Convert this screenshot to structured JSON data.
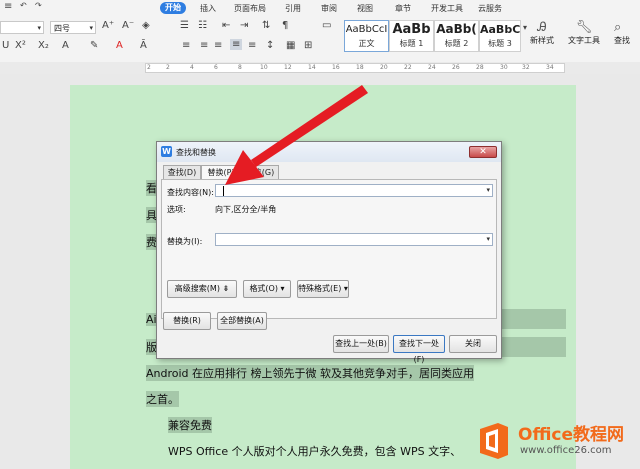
{
  "ribbon": {
    "tabs": [
      "开始",
      "插入",
      "页面布局",
      "引用",
      "审阅",
      "视图",
      "章节",
      "开发工具",
      "云服务"
    ],
    "font_size_value": "四号",
    "styles": [
      {
        "preview": "AaBbCcI",
        "name": "正文"
      },
      {
        "preview": "AaBb",
        "name": "标题 1"
      },
      {
        "preview": "AaBb(",
        "name": "标题 2"
      },
      {
        "preview": "AaBbC",
        "name": "标题 3"
      }
    ],
    "new_style_label": "新样式",
    "text_tools_label": "文字工具",
    "find_replace_label": "查找"
  },
  "ruler": {
    "numbers": [
      "2",
      "2",
      "4",
      "6",
      "8",
      "10",
      "12",
      "14",
      "16",
      "18",
      "20",
      "22",
      "24",
      "26",
      "28",
      "30",
      "32",
      "34"
    ]
  },
  "document": {
    "lines": [
      "看",
      "具",
      "费",
      "（",
      "Ai",
      "版",
      "Android 在应用排行  榜上领先于微  软及其他竞争对手，居同类应用",
      "之首。",
      "兼容免费",
      "WPS Office 个人版对个人用户永久免费，包含  WPS 文字、"
    ]
  },
  "dialog": {
    "title": "查找和替换",
    "tabs": [
      "查找(D)",
      "替换(P)",
      "定位(G)"
    ],
    "find_label": "查找内容(N):",
    "find_value": "",
    "options_label": "选项:",
    "options_value": "向下,区分全/半角",
    "replace_label": "替换为(I):",
    "replace_value": "",
    "advanced_search_btn": "高级搜索(M) ⇟",
    "format_btn": "格式(O) ▾",
    "special_format_btn": "特殊格式(E) ▾",
    "replace_btn": "替换(R)",
    "replace_all_btn": "全部替换(A)",
    "find_prev_btn": "查找上一处(B)",
    "find_next_btn": "查找下一处(F)",
    "close_btn": "关闭"
  },
  "watermark": {
    "brand": "Office教程网",
    "url": "www.office26.com"
  },
  "colors": {
    "accent": "#2e7de1",
    "page": "#c6ebc9",
    "arrow": "#e51c23",
    "logo_orange": "#f26a1b"
  }
}
